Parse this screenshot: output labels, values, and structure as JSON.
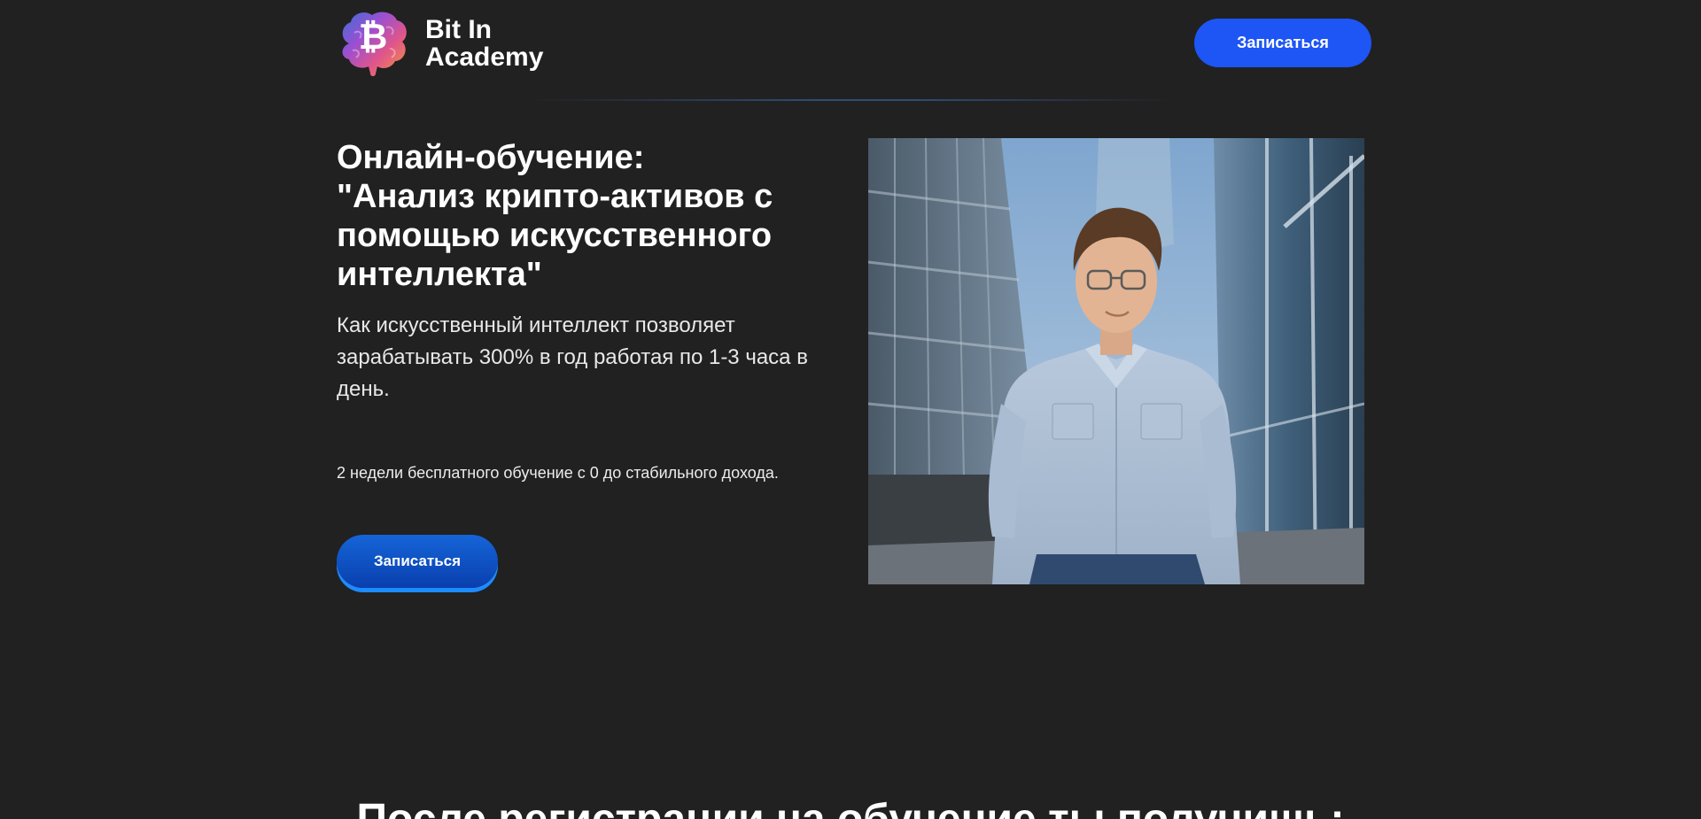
{
  "header": {
    "brand": "Bit In\nAcademy",
    "logo_icon": "bitcoin-brain-icon",
    "cta_label": "Записаться"
  },
  "hero": {
    "title": "Онлайн-обучение:\n\"Анализ крипто-активов с помощью искусственного интеллекта\"",
    "lead": "Как искусственный интеллект позволяет зарабатывать 300% в год работая по 1-3 часа в день.",
    "note": "2 недели бесплатного обучение с 0 до стабильного дохода.",
    "cta_label": "Записаться",
    "photo_subject": "man-in-shirt-photo"
  },
  "next_section": {
    "title": "После регистрации на обучение ты получишь:"
  },
  "colors": {
    "background": "#212121",
    "accent_blue": "#1e55f5",
    "cta_gradient_top": "#1565d8",
    "cta_gradient_bottom": "#0a3fae"
  }
}
